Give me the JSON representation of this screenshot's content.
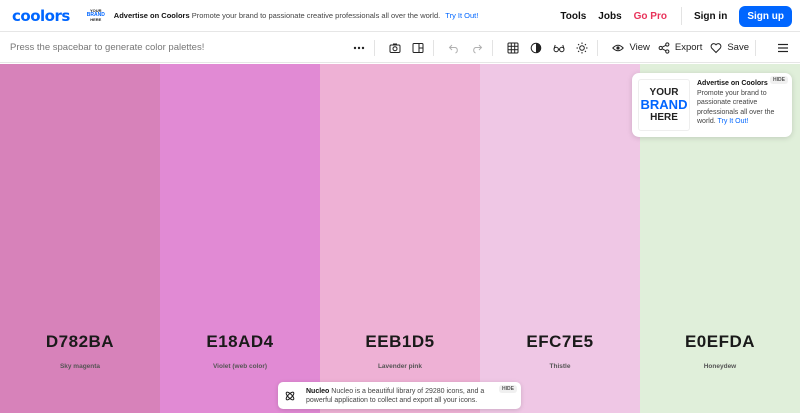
{
  "brand": {
    "logo_text": "coolors"
  },
  "top_ad": {
    "mini_brand": [
      "YOUR",
      "BRAND",
      "HERE"
    ],
    "title": "Advertise on Coolors",
    "text": "Promote your brand to passionate creative professionals all over the world.",
    "cta": "Try It Out!"
  },
  "nav": {
    "tools": "Tools",
    "jobs": "Jobs",
    "go_pro": "Go Pro",
    "sign_in": "Sign in",
    "sign_up": "Sign up"
  },
  "toolbar": {
    "hint": "Press the spacebar to generate color palettes!",
    "view": "View",
    "export": "Export",
    "save": "Save"
  },
  "palette": [
    {
      "hex": "D782BA",
      "name": "Sky magenta",
      "color": "#D782BA"
    },
    {
      "hex": "E18AD4",
      "name": "Violet (web color)",
      "color": "#E18AD4"
    },
    {
      "hex": "EEB1D5",
      "name": "Lavender pink",
      "color": "#EEB1D5"
    },
    {
      "hex": "EFC7E5",
      "name": "Thistle",
      "color": "#EFC7E5"
    },
    {
      "hex": "E0EFDA",
      "name": "Honeydew",
      "color": "#E0EFDA"
    }
  ],
  "ad_card": {
    "brand": [
      "YOUR",
      "BRAND",
      "HERE"
    ],
    "title": "Advertise on Coolors",
    "text": "Promote your brand to passionate creative professionals all over the world.",
    "cta": "Try It Out!",
    "hide": "HIDE"
  },
  "notice": {
    "title": "Nucleo",
    "text": "Nucleo is a beautiful library of 29280 icons, and a powerful application to collect and export all your icons.",
    "hide": "HIDE"
  },
  "colors": {
    "accent": "#0066ff",
    "pro": "#e8335a"
  }
}
